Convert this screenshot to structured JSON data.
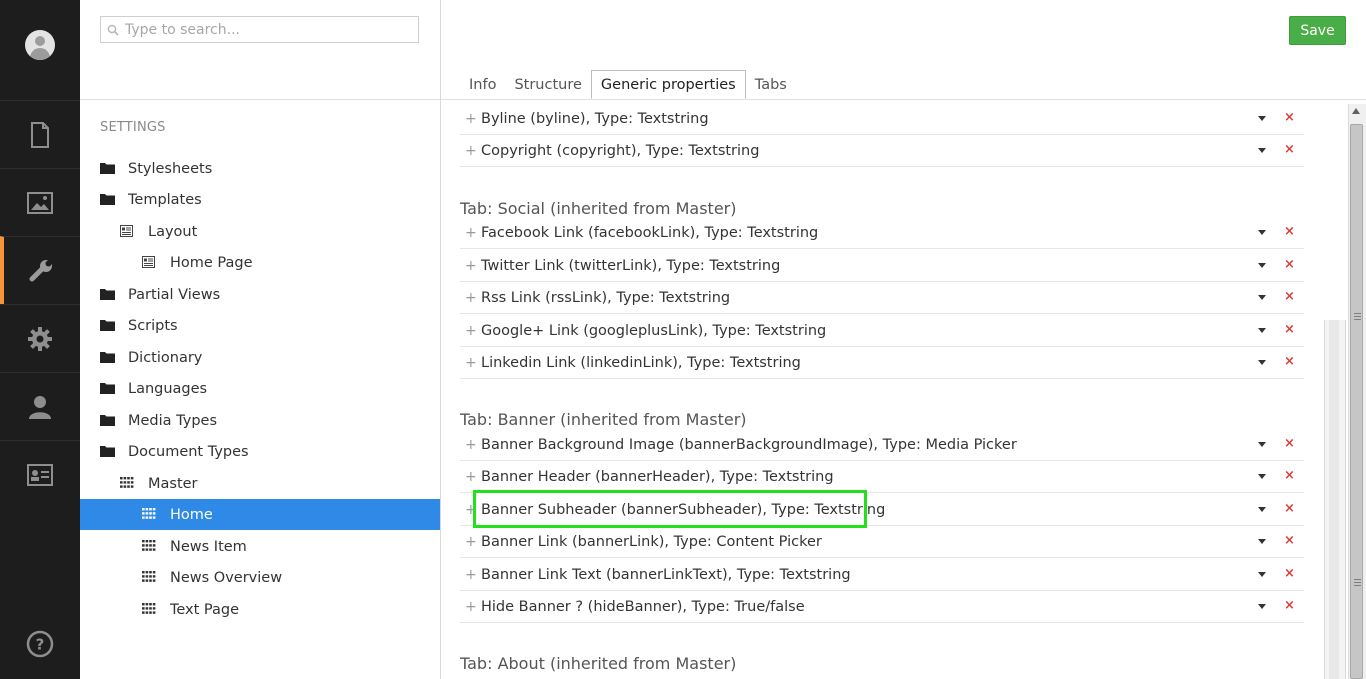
{
  "search": {
    "placeholder": "Type to search..."
  },
  "tree": {
    "section_title": "SETTINGS",
    "items": [
      {
        "label": "Stylesheets",
        "icon": "folder-icon",
        "level": 0
      },
      {
        "label": "Templates",
        "icon": "folder-icon",
        "level": 0
      },
      {
        "label": "Layout",
        "icon": "template-icon",
        "level": 1
      },
      {
        "label": "Home Page",
        "icon": "template-icon",
        "level": 2
      },
      {
        "label": "Partial Views",
        "icon": "folder-icon",
        "level": 0
      },
      {
        "label": "Scripts",
        "icon": "folder-icon",
        "level": 0
      },
      {
        "label": "Dictionary",
        "icon": "folder-icon",
        "level": 0
      },
      {
        "label": "Languages",
        "icon": "folder-icon",
        "level": 0
      },
      {
        "label": "Media Types",
        "icon": "folder-icon",
        "level": 0
      },
      {
        "label": "Document Types",
        "icon": "folder-icon",
        "level": 0
      },
      {
        "label": "Master",
        "icon": "doctype-grid-icon",
        "level": 1
      },
      {
        "label": "Home",
        "icon": "doctype-grid-icon",
        "level": 2,
        "selected": true
      },
      {
        "label": "News Item",
        "icon": "doctype-grid-icon",
        "level": 2
      },
      {
        "label": "News Overview",
        "icon": "doctype-grid-icon",
        "level": 2
      },
      {
        "label": "Text Page",
        "icon": "doctype-grid-icon",
        "level": 2
      }
    ]
  },
  "toolbar": {
    "save_label": "Save"
  },
  "tabs": [
    {
      "label": "Info"
    },
    {
      "label": "Structure"
    },
    {
      "label": "Generic properties",
      "active": true
    },
    {
      "label": "Tabs"
    }
  ],
  "groups": {
    "social_title": "Tab: Social (inherited from Master)",
    "banner_title": "Tab: Banner (inherited from Master)",
    "about_title": "Tab: About (inherited from Master)"
  },
  "properties": {
    "top": [
      "Byline (byline), Type: Textstring",
      "Copyright (copyright), Type: Textstring"
    ],
    "social": [
      "Facebook Link (facebookLink), Type: Textstring",
      "Twitter Link (twitterLink), Type: Textstring",
      "Rss Link (rssLink), Type: Textstring",
      "Google+ Link (googleplusLink), Type: Textstring",
      "Linkedin Link (linkedinLink), Type: Textstring"
    ],
    "banner": [
      "Banner Background Image (bannerBackgroundImage), Type: Media Picker",
      "Banner Header (bannerHeader), Type: Textstring",
      "Banner Subheader (bannerSubheader), Type: Textstring",
      "Banner Link (bannerLink), Type: Content Picker",
      "Banner Link Text (bannerLinkText), Type: Textstring",
      "Hide Banner ? (hideBanner), Type: True/false"
    ]
  },
  "row_controls": {
    "delete_glyph": "×"
  },
  "highlighted_property": "Banner Subheader (bannerSubheader), Type: Textstring",
  "appbar_sections": [
    "content-icon",
    "media-icon",
    "settings-wrench-icon",
    "developer-gear-icon",
    "users-icon",
    "members-card-icon",
    "help-icon"
  ],
  "colors": {
    "appbar_bg": "#1d1d1d",
    "active_section": "#f5953a",
    "selected_tree": "#2e8ae6",
    "save_green": "#4aae48",
    "highlight_box": "#22e01a",
    "delete_red": "#d9403a"
  }
}
